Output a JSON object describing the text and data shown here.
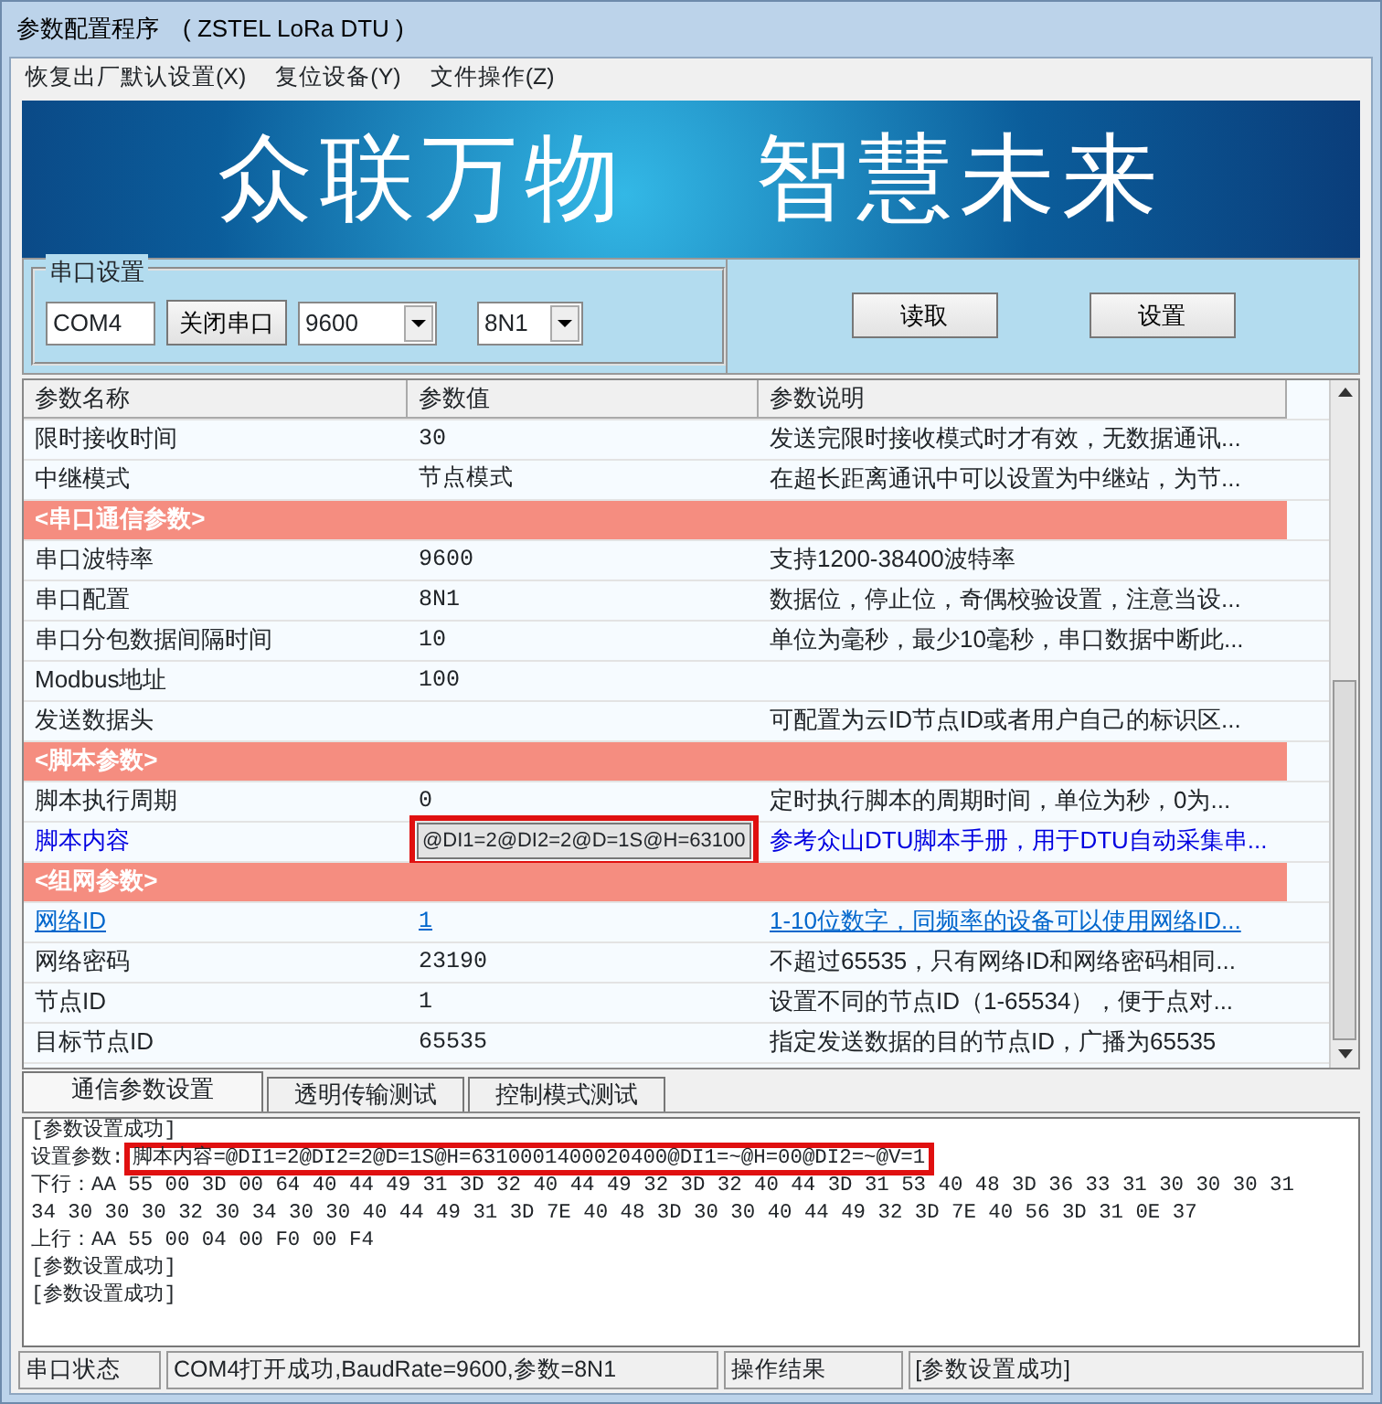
{
  "window": {
    "title": "参数配置程序　( ZSTEL LoRa DTU )"
  },
  "menu": [
    "恢复出厂默认设置(X)",
    "复位设备(Y)",
    "文件操作(Z)"
  ],
  "banner": {
    "left": "众联万物",
    "right": "智慧未来"
  },
  "serial": {
    "group_label": "串口设置",
    "port": "COM4",
    "close_button": "关闭串口",
    "baud": "9600",
    "format": "8N1"
  },
  "actions": [
    "读取",
    "设置"
  ],
  "table": {
    "columns": [
      "参数名称",
      "参数值",
      "参数说明"
    ],
    "rows": [
      {
        "kind": "normal",
        "name": "限时接收时间",
        "value": "30",
        "desc": "发送完限时接收模式时才有效，无数据通讯..."
      },
      {
        "kind": "normal",
        "name": "中继模式",
        "value": "节点模式",
        "desc": "在超长距离通讯中可以设置为中继站，为节..."
      },
      {
        "kind": "section",
        "name": "<串口通信参数>"
      },
      {
        "kind": "normal",
        "name": "串口波特率",
        "value": "9600",
        "desc": "支持1200-38400波特率"
      },
      {
        "kind": "normal",
        "name": "串口配置",
        "value": "8N1",
        "desc": "数据位，停止位，奇偶校验设置，注意当设..."
      },
      {
        "kind": "normal",
        "name": "串口分包数据间隔时间",
        "value": "10",
        "desc": "单位为毫秒，最少10毫秒，串口数据中断此..."
      },
      {
        "kind": "normal",
        "name": "Modbus地址",
        "value": "100",
        "desc": ""
      },
      {
        "kind": "normal",
        "name": "发送数据头",
        "value": "",
        "desc": "可配置为云ID节点ID或者用户自己的标识区..."
      },
      {
        "kind": "section",
        "name": "<脚本参数>"
      },
      {
        "kind": "normal",
        "name": "脚本执行周期",
        "value": "0",
        "desc": "定时执行脚本的周期时间，单位为秒，0为..."
      },
      {
        "kind": "blue",
        "name": "脚本内容",
        "value": "@DI1=2@DI2=2@D=1S@H=63100",
        "desc": "参考众山DTU脚本手册，用于DTU自动采集串...",
        "editing": true
      },
      {
        "kind": "section",
        "name": "<组网参数>"
      },
      {
        "kind": "link",
        "name": "网络ID",
        "value": "1",
        "desc": "1-10位数字，同频率的设备可以使用网络ID..."
      },
      {
        "kind": "normal",
        "name": "网络密码",
        "value": "23190",
        "desc": "不超过65535，只有网络ID和网络密码相同..."
      },
      {
        "kind": "normal",
        "name": "节点ID",
        "value": "1",
        "desc": "设置不同的节点ID（1-65534），便于点对..."
      },
      {
        "kind": "normal",
        "name": "目标节点ID",
        "value": "65535",
        "desc": "指定发送数据的目的节点ID，广播为65535"
      }
    ]
  },
  "tabs": [
    {
      "label": "通信参数设置",
      "selected": true
    },
    {
      "label": "透明传输测试",
      "selected": false
    },
    {
      "label": "控制模式测试",
      "selected": false
    }
  ],
  "log": [
    {
      "text": "[参数设置成功]"
    },
    {
      "text": "设置参数:",
      "boxed": "脚本内容=@DI1=2@DI2=2@D=1S@H=6310001400020400@DI1=~@H=00@DI2=~@V=1"
    },
    {
      "text": "下行：AA 55 00 3D 00 64 40 44 49 31 3D 32 40 44 49 32 3D 32 40 44 3D 31 53 40 48 3D 36 33 31 30 30 30 31"
    },
    {
      "text": "34 30 30 30 32 30 34 30 30 40 44 49 31 3D 7E 40 48 3D 30 30 40 44 49 32 3D 7E 40 56 3D 31 0E 37"
    },
    {
      "text": "上行：AA 55 00 04 00 F0 00 F4"
    },
    {
      "text": "[参数设置成功]"
    },
    {
      "text": "[参数设置成功]"
    }
  ],
  "status_bar": [
    "串口状态",
    "COM4打开成功,BaudRate=9600,参数=8N1",
    "操作结果",
    "[参数设置成功]"
  ]
}
